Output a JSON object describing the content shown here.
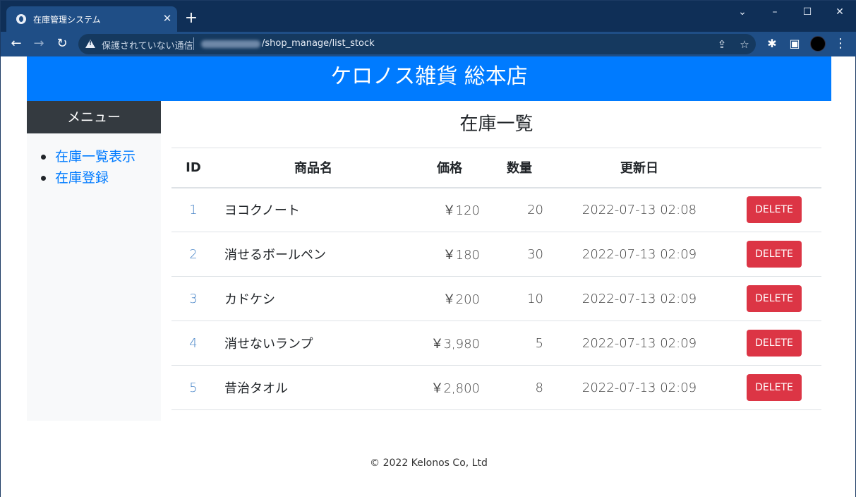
{
  "browser": {
    "tab_title": "在庫管理システム",
    "security_text": "保護されていない通信",
    "url_path": "/shop_manage/list_stock"
  },
  "header": {
    "title": "ケロノス雑貨 総本店"
  },
  "sidebar": {
    "title": "メニュー",
    "items": [
      {
        "label": "在庫一覧表示"
      },
      {
        "label": "在庫登録"
      }
    ]
  },
  "main": {
    "title": "在庫一覧",
    "columns": [
      "ID",
      "商品名",
      "価格",
      "数量",
      "更新日",
      ""
    ],
    "delete_label": "DELETE",
    "rows": [
      {
        "id": "1",
        "name": "ヨコクノート",
        "price": "￥120",
        "qty": "20",
        "updated": "2022-07-13 02:08"
      },
      {
        "id": "2",
        "name": "消せるボールペン",
        "price": "￥180",
        "qty": "30",
        "updated": "2022-07-13 02:09"
      },
      {
        "id": "3",
        "name": "カドケシ",
        "price": "￥200",
        "qty": "10",
        "updated": "2022-07-13 02:09"
      },
      {
        "id": "4",
        "name": "消せないランプ",
        "price": "￥3,980",
        "qty": "5",
        "updated": "2022-07-13 02:09"
      },
      {
        "id": "5",
        "name": "昔治タオル",
        "price": "￥2,800",
        "qty": "8",
        "updated": "2022-07-13 02:09"
      }
    ]
  },
  "footer": {
    "text": "© 2022 Kelonos Co, Ltd"
  },
  "colors": {
    "header": "#007bff",
    "menu_title": "#343a40",
    "delete": "#dc3545",
    "browser_frame": "#0f2f57"
  }
}
